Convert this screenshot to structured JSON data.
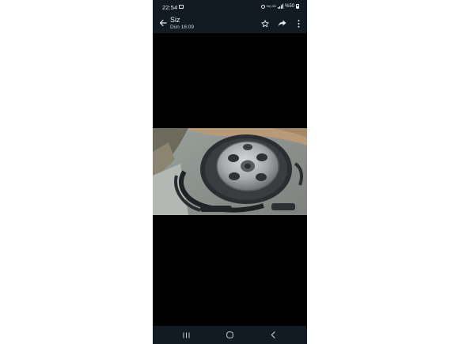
{
  "status_bar": {
    "time": "22:54",
    "volte": "Vo) 4G",
    "battery": "%50",
    "icons": [
      "gallery-icon",
      "alarm-icon",
      "signal-icon",
      "battery-icon"
    ]
  },
  "toolbar": {
    "contact_name": "Siz",
    "timestamp": "Dün 16:09",
    "icons": [
      "back-arrow-icon",
      "star-icon",
      "forward-icon",
      "more-vert-icon"
    ]
  },
  "media": {
    "content": "photo of spare tire in car trunk well"
  },
  "nav_bar": {
    "icons": [
      "recents-icon",
      "home-icon",
      "back-icon"
    ]
  },
  "colors": {
    "bar_background": "#111b21",
    "bar_foreground": "#e9edef",
    "viewer_background": "#000000"
  }
}
